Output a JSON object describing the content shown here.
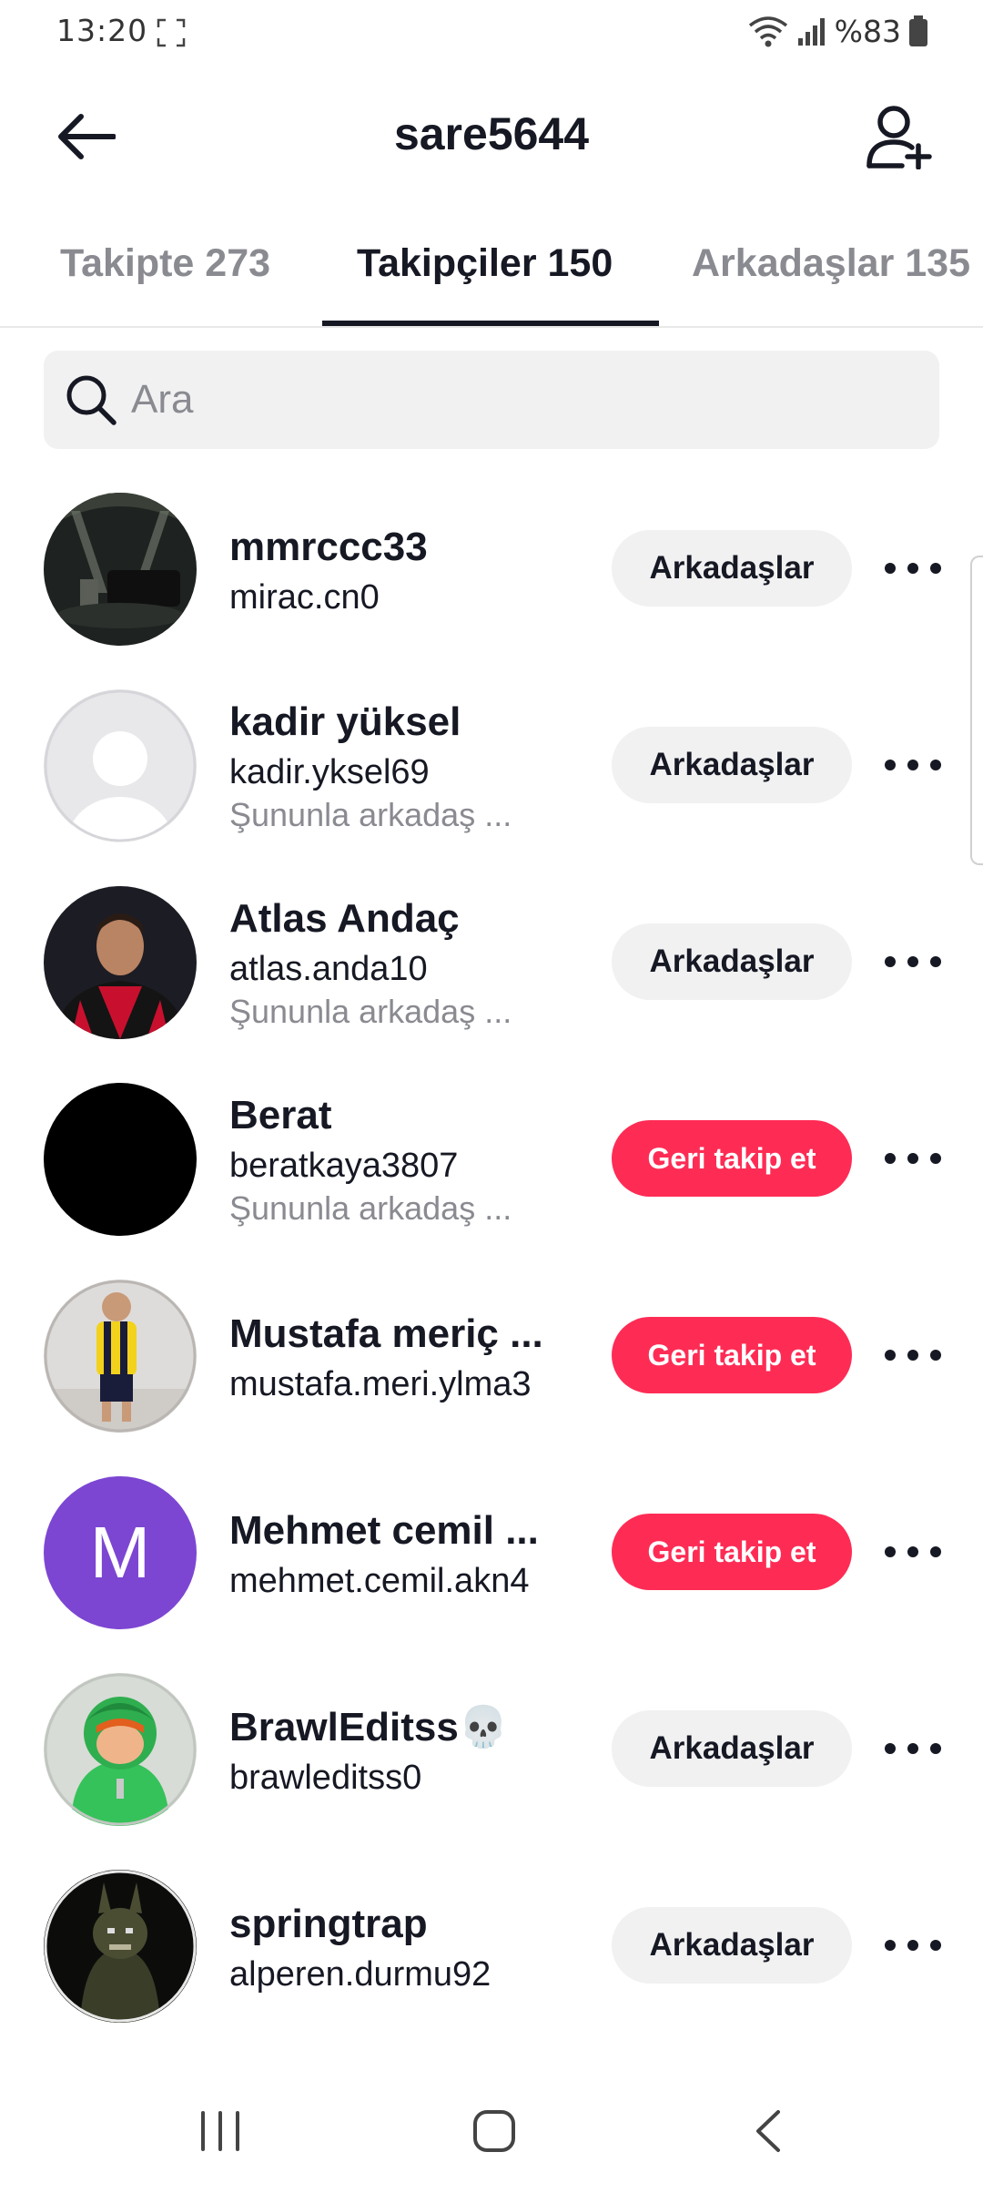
{
  "status_bar": {
    "time": "13:20",
    "battery": "%83"
  },
  "header": {
    "title": "sare5644"
  },
  "tabs": [
    {
      "label": "Takipte 273",
      "active": false
    },
    {
      "label": "Takipçiler 150",
      "active": true
    },
    {
      "label": "Arkadaşlar 135",
      "active": false
    }
  ],
  "search": {
    "placeholder": "Ara",
    "value": ""
  },
  "followers": [
    {
      "display_name": "mmrccc33",
      "username": "mirac.cn0",
      "subtitle": "",
      "action": "Arkadaşlar",
      "action_type": "friends",
      "avatar": "photo-dark"
    },
    {
      "display_name": "kadir yüksel",
      "username": "kadir.yksel69",
      "subtitle": "Şununla arkadaş ...",
      "action": "Arkadaşlar",
      "action_type": "friends",
      "avatar": "default-placeholder"
    },
    {
      "display_name": "Atlas Andaç",
      "username": "atlas.anda10",
      "subtitle": "Şununla arkadaş ...",
      "action": "Arkadaşlar",
      "action_type": "friends",
      "avatar": "photo-player"
    },
    {
      "display_name": "Berat",
      "username": "beratkaya3807",
      "subtitle": "Şununla arkadaş ...",
      "action": "Geri takip et",
      "action_type": "follow",
      "avatar": "solid-black"
    },
    {
      "display_name": "Mustafa meriç ...",
      "username": "mustafa.meri.ylma3",
      "subtitle": "",
      "action": "Geri takip et",
      "action_type": "follow",
      "avatar": "photo-child"
    },
    {
      "display_name": "Mehmet cemil ...",
      "username": "mehmet.cemil.akn4",
      "subtitle": "",
      "action": "Geri takip et",
      "action_type": "follow",
      "avatar": "letter",
      "avatar_letter": "M"
    },
    {
      "display_name": "BrawlEditss💀",
      "username": "brawleditss0",
      "subtitle": "",
      "action": "Arkadaşlar",
      "action_type": "friends",
      "avatar": "photo-green-character"
    },
    {
      "display_name": "springtrap",
      "username": "alperen.durmu92",
      "subtitle": "",
      "action": "Arkadaşlar",
      "action_type": "friends",
      "avatar": "photo-dark-figure"
    }
  ],
  "colors": {
    "accent": "#fe2c55",
    "button_gray": "#f1f1f2",
    "text_primary": "#161823",
    "text_secondary": "#8a8b91",
    "avatar_purple": "#7c46d2"
  },
  "icons": {
    "back": "arrow-left-icon",
    "add_friend": "person-plus-icon",
    "search": "search-icon",
    "more": "more-dots-icon"
  }
}
